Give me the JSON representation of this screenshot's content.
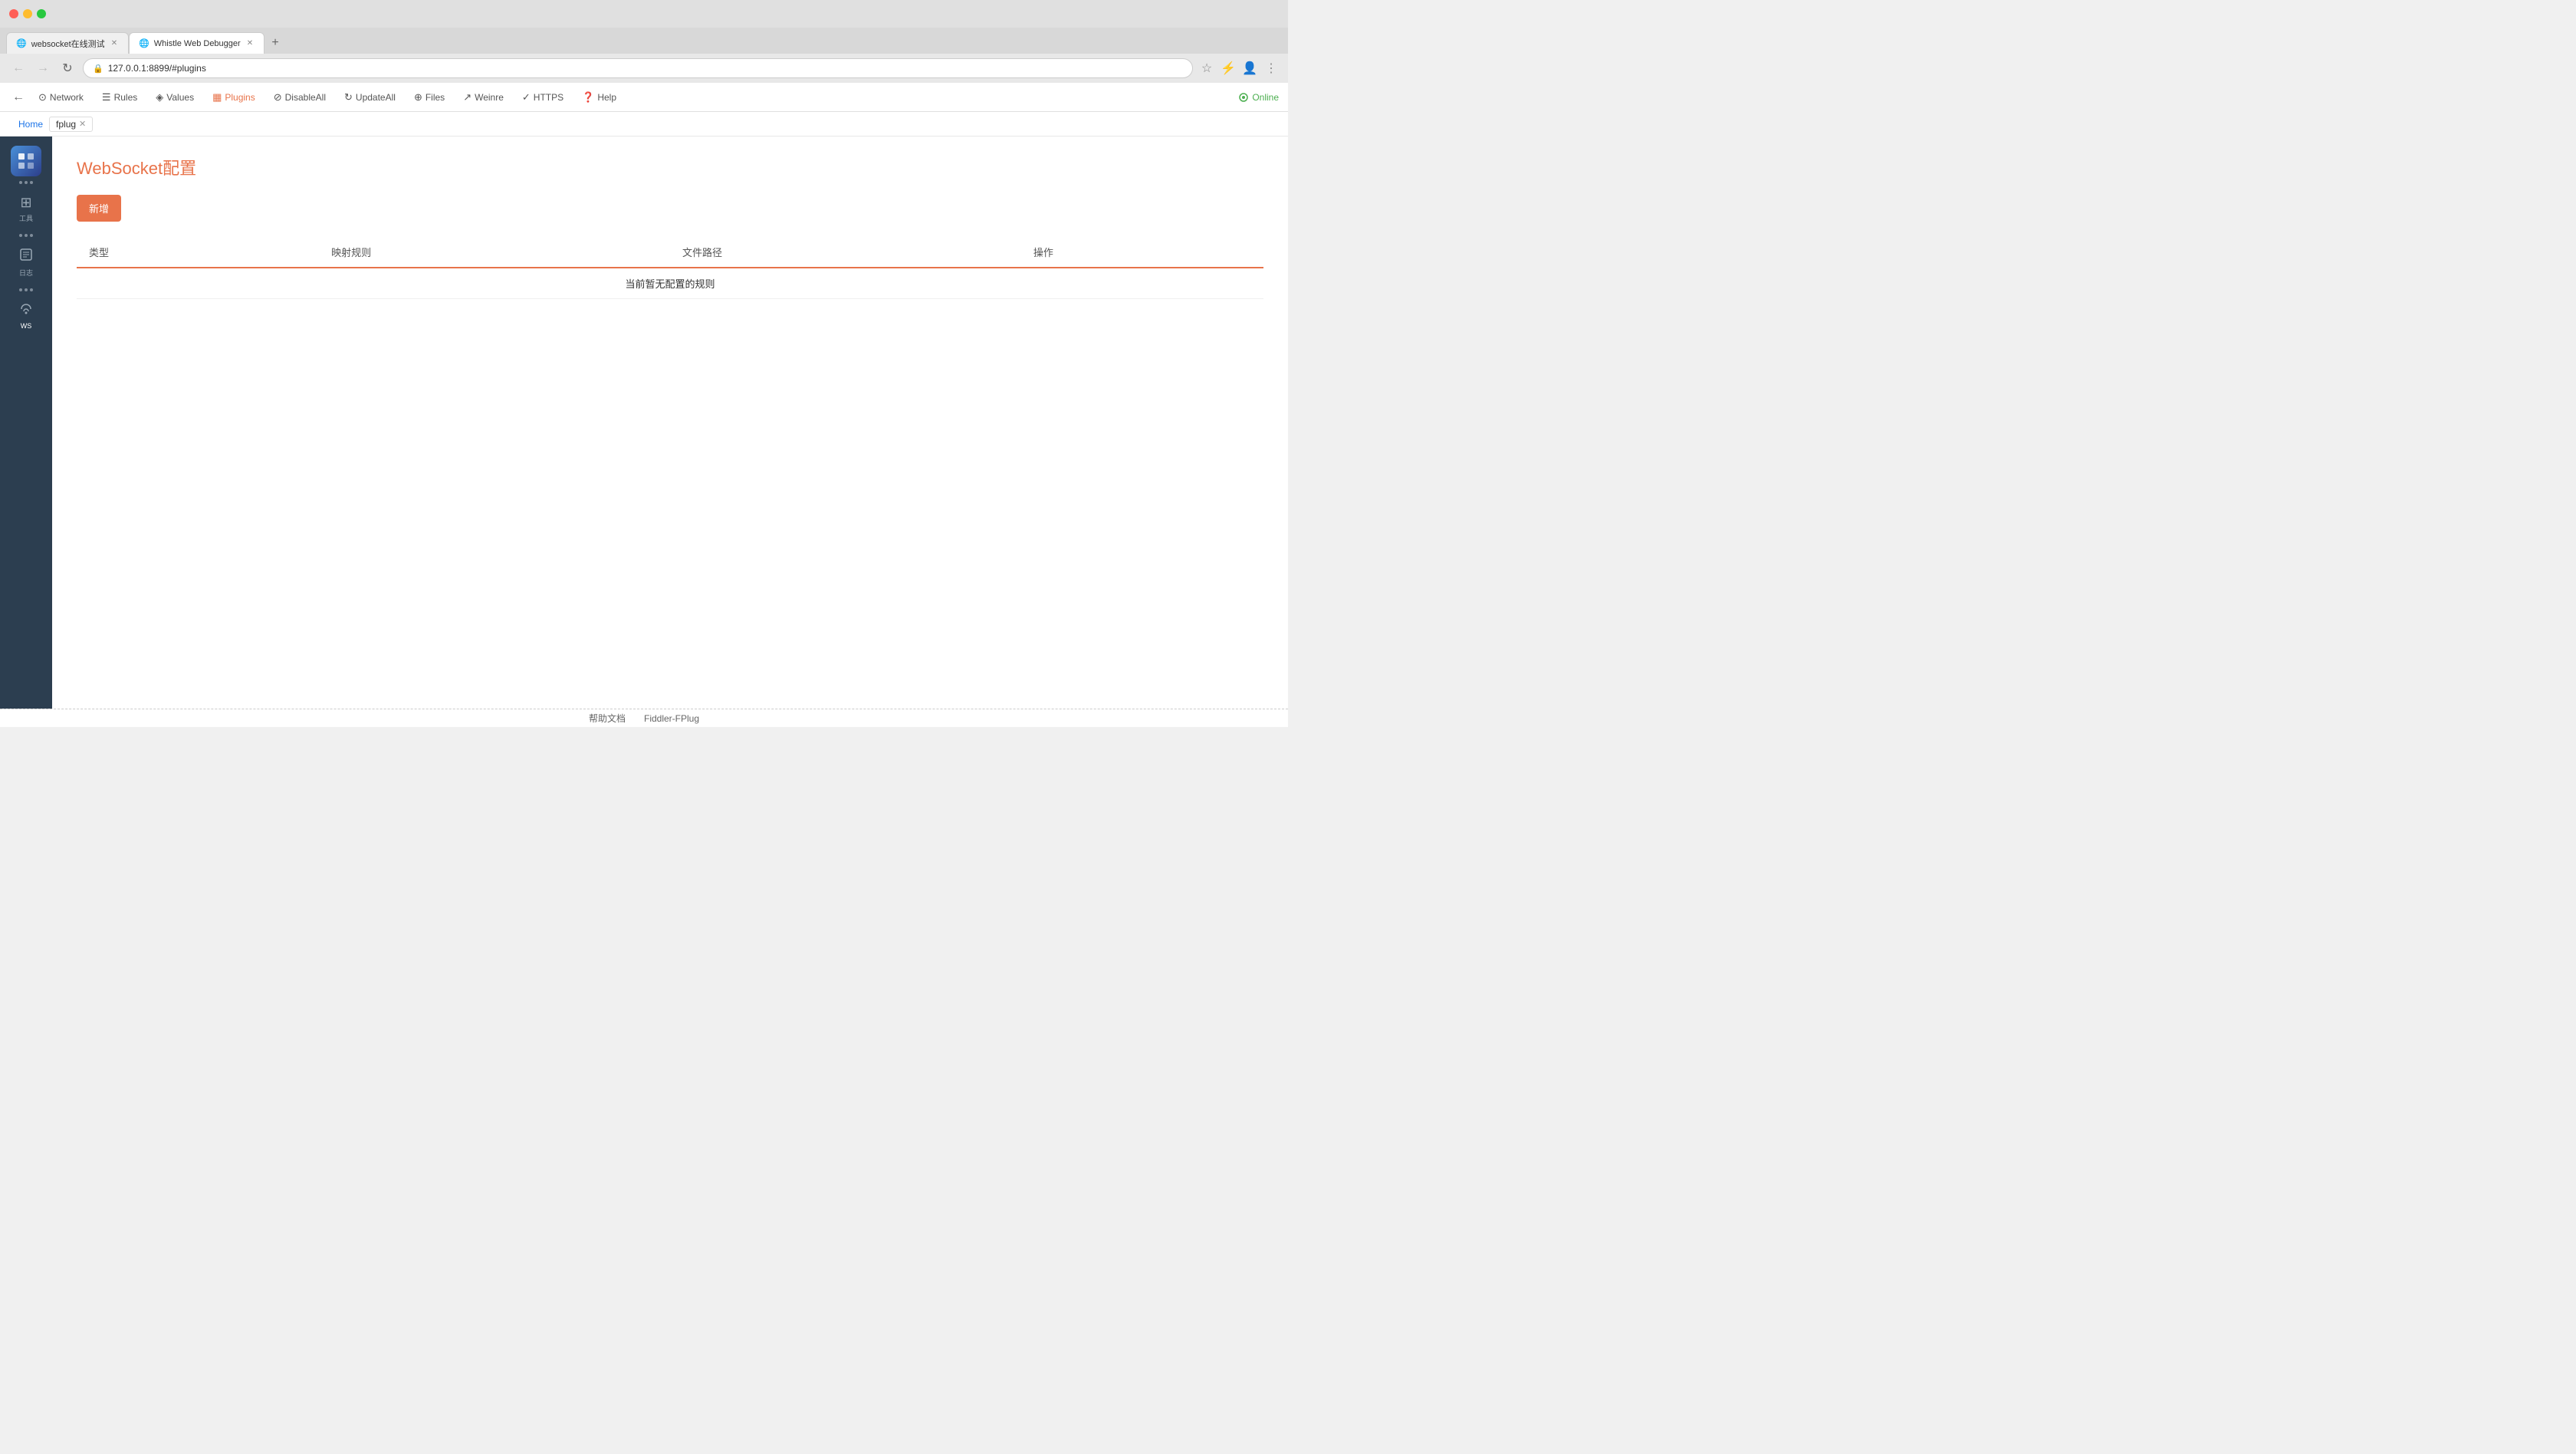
{
  "browser": {
    "tabs": [
      {
        "id": "tab1",
        "favicon": "🔵",
        "title": "websocket在线测试",
        "active": false
      },
      {
        "id": "tab2",
        "favicon": "🟠",
        "title": "Whistle Web Debugger",
        "active": true
      }
    ],
    "address": "127.0.0.1:8899/#plugins"
  },
  "nav": {
    "back_icon": "←",
    "forward_icon": "→",
    "reload_icon": "↻",
    "items": [
      {
        "id": "network",
        "icon": "⊙",
        "label": "Network",
        "active": false
      },
      {
        "id": "rules",
        "icon": "☰",
        "label": "Rules",
        "active": false
      },
      {
        "id": "values",
        "icon": "◈",
        "label": "Values",
        "active": false
      },
      {
        "id": "plugins",
        "icon": "▦",
        "label": "Plugins",
        "active": true
      },
      {
        "id": "disableall",
        "icon": "⊘",
        "label": "DisableAll",
        "active": false
      },
      {
        "id": "updateall",
        "icon": "↻",
        "label": "UpdateAll",
        "active": false
      },
      {
        "id": "files",
        "icon": "⊕",
        "label": "Files",
        "active": false
      },
      {
        "id": "weinre",
        "icon": "↗",
        "label": "Weinre",
        "active": false
      },
      {
        "id": "https",
        "icon": "✓",
        "label": "HTTPS",
        "active": false
      },
      {
        "id": "help",
        "icon": "❓",
        "label": "Help",
        "active": false
      }
    ],
    "online_label": "Online"
  },
  "breadcrumb": {
    "home_label": "Home",
    "active_label": "fplug"
  },
  "sidebar": {
    "items": [
      {
        "id": "tools",
        "icon": "⊞",
        "label": "工具"
      },
      {
        "id": "log",
        "icon": "≡",
        "label": "日志"
      },
      {
        "id": "ws",
        "icon": "∞",
        "label": "WS"
      }
    ]
  },
  "main": {
    "title": "WebSocket配置",
    "add_button_label": "新增",
    "table": {
      "columns": [
        "类型",
        "映射规则",
        "文件路径",
        "操作"
      ],
      "empty_message": "当前暂无配置的规则",
      "rows": []
    }
  },
  "footer": {
    "links": [
      "帮助文档",
      "Fiddler-FPlug"
    ]
  }
}
